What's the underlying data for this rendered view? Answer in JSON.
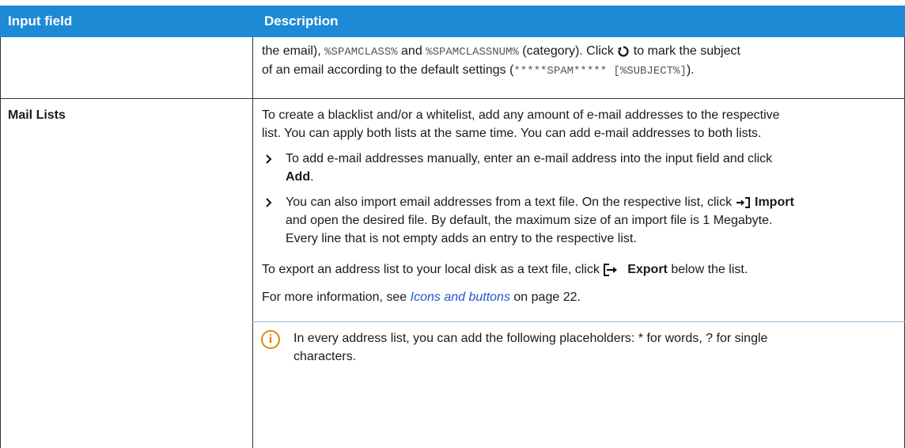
{
  "table": {
    "headers": {
      "input_field": "Input field",
      "description": "Description"
    },
    "row1": {
      "line1_a": "the email),",
      "code_spamclass": "%SPAMCLASS%",
      "line1_b": "and",
      "code_spamclassnum": "%SPAMCLASSNUM%",
      "line1_c": "(category). Click",
      "line1_d": "to mark the subject",
      "line2_a": "of an email according to the default settings (",
      "code_default": "*****SPAM***** [%SUBJECT%]",
      "line2_b": ")."
    },
    "row2": {
      "field": "Mail Lists",
      "para1_line1": "To create a blacklist and/or a whitelist, add any amount of e-mail addresses to the respective",
      "para1_line2": "list. You can apply both lists at the same time. You can add e-mail addresses to both lists.",
      "bullet1_line1": "To add e-mail addresses manually, enter an e-mail address into the input field and click",
      "bullet1_bold": "Add",
      "bullet1_end": ".",
      "bullet2_line1": "You can also import email addresses from a text file. On the respective list, click",
      "bullet2_bold": "Import",
      "bullet2_line2": "and open the desired file. By default, the maximum size of an import file is 1 Megabyte.",
      "bullet2_line3": "Every line that is not empty adds an entry to the respective list.",
      "export_a": "To export an address list to your local disk as a text file, click",
      "export_bold": "Export",
      "export_b": "below the list.",
      "more_a": "For more information, see",
      "more_link": "Icons and buttons",
      "more_b": "on page 22.",
      "note_line1": "In every address list, you can add the following placeholders: * for words, ? for single",
      "note_line2": "characters."
    }
  },
  "icons": {
    "reset": "reset-icon",
    "import": "import-icon",
    "export": "export-icon",
    "info": "info-icon",
    "bullet": "chevron-right-icon"
  },
  "colors": {
    "header_bg": "#1d8ad6",
    "link": "#2255cc",
    "info": "#e08a00"
  }
}
